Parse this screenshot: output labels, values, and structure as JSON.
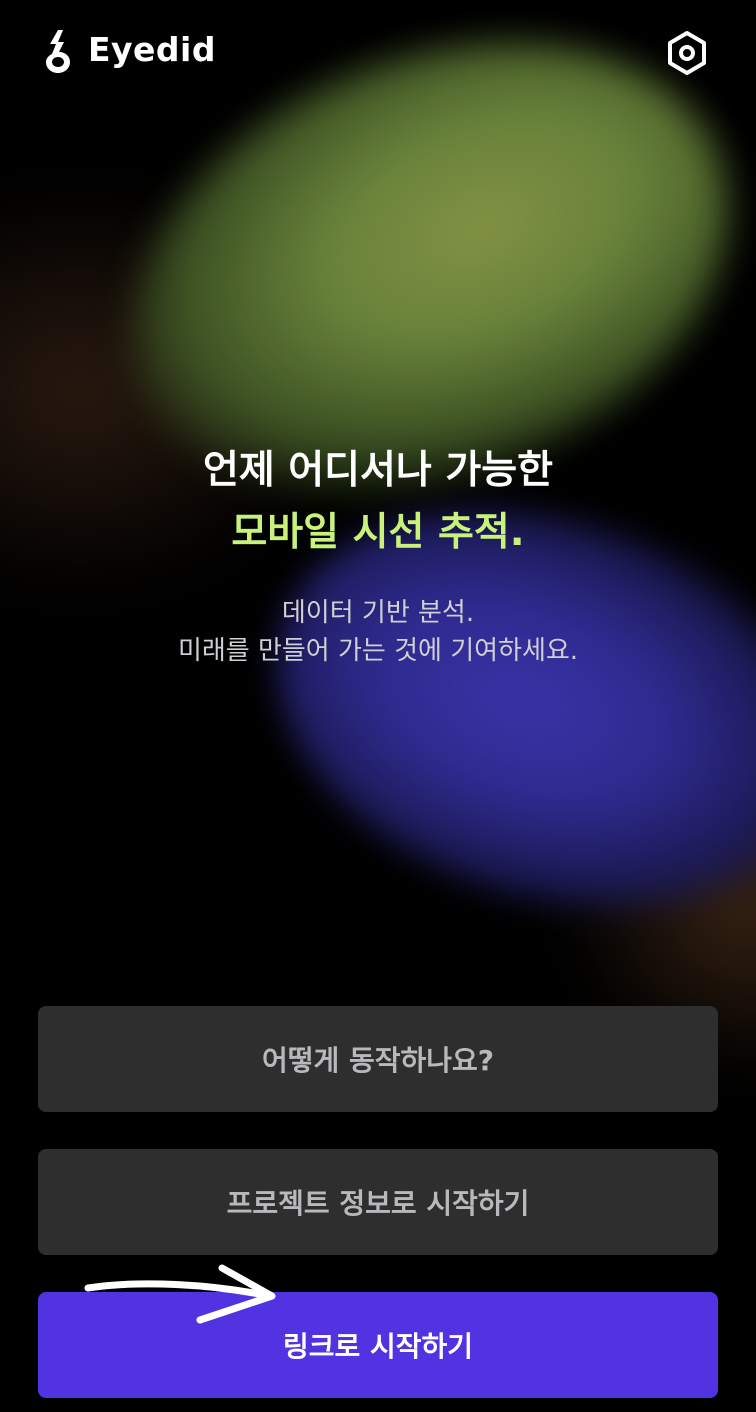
{
  "header": {
    "app_name": "Eyedid",
    "logo_icon": "eyedid-logo-icon",
    "settings_icon": "gear-icon"
  },
  "hero": {
    "title_line1": "언제 어디서나 가능한",
    "title_line2": "모바일 시선 추적.",
    "subtitle_line1": "데이터 기반 분석.",
    "subtitle_line2": "미래를 만들어 가는 것에 기여하세요."
  },
  "buttons": {
    "how_it_works": "어떻게 동작하나요?",
    "start_with_project": "프로젝트 정보로 시작하기",
    "start_with_link": "링크로 시작하기"
  },
  "colors": {
    "accent_green": "#c8f27a",
    "primary_button": "#5233e2",
    "secondary_button": "#2e2e2e",
    "background": "#000000"
  }
}
